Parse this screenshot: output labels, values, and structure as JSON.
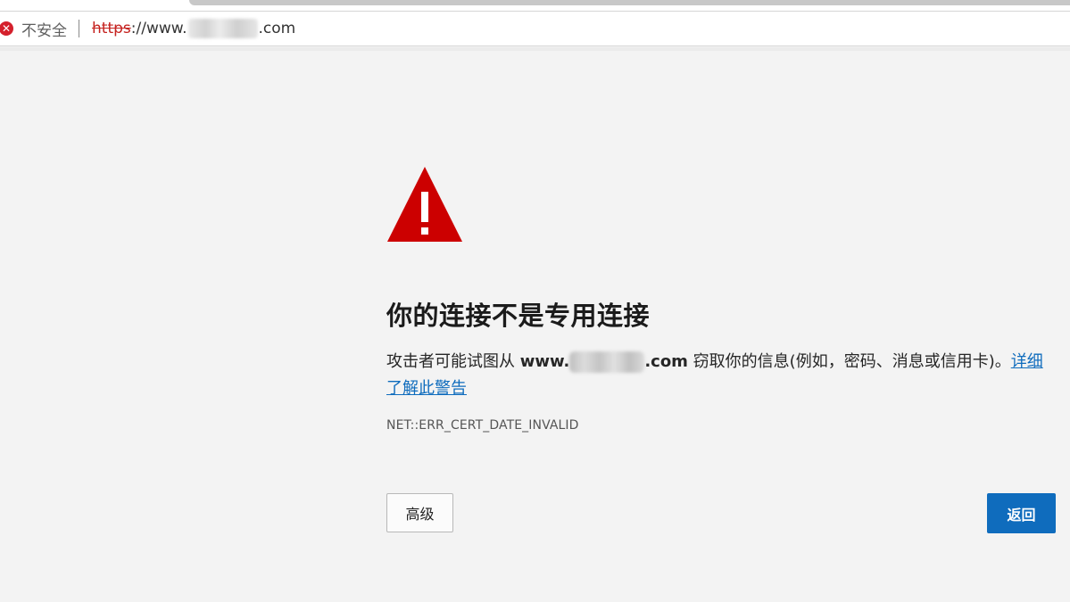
{
  "address_bar": {
    "security_label": "不安全",
    "url_scheme": "https",
    "url_prefix": "://www.",
    "url_suffix": ".com"
  },
  "page": {
    "heading": "你的连接不是专用连接",
    "desc_prefix": "攻击者可能试图从 ",
    "desc_host_prefix": "www.",
    "desc_host_suffix": ".com",
    "desc_middle": " 窃取你的信息(例如，密码、消息或信用卡)。",
    "learn_more_link": "详细了解此警告",
    "error_code": "NET::ERR_CERT_DATE_INVALID"
  },
  "buttons": {
    "advanced_label": "高级",
    "back_label": "返回"
  },
  "colors": {
    "warning_red": "#cc0000",
    "accent_blue": "#0f6cbd",
    "insecure_red": "#d4202c"
  },
  "icons": {
    "security": "close-circle-icon",
    "warning": "warning-triangle-icon"
  }
}
